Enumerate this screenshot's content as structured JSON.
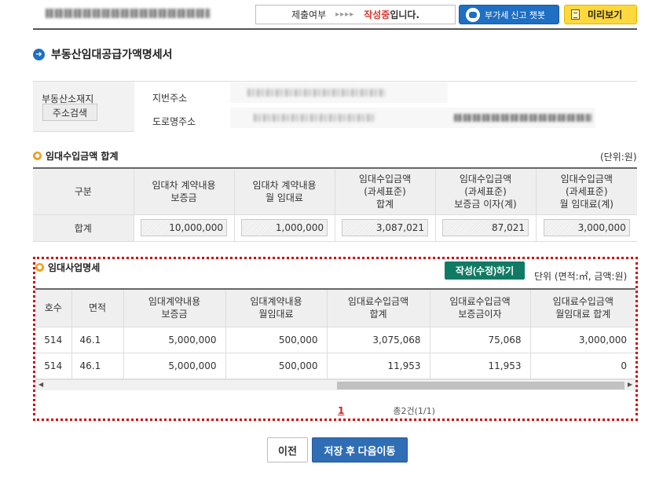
{
  "header": {
    "status_prefix": "제출여부",
    "status_arrows": "▸▸▸▸",
    "status_value": "작성중",
    "status_suffix": "입니다.",
    "chatbot_label": "부가세 신고 챗봇",
    "preview_label": "미리보기"
  },
  "page": {
    "title": "부동산임대공급가액명세서"
  },
  "address": {
    "label": "부동산소재지",
    "search_button": "주소검색",
    "jibun_label": "지번주소",
    "road_label": "도로명주소"
  },
  "summary": {
    "title": "임대수입금액 합계",
    "unit": "(단위:원)",
    "headers": [
      [
        "구분"
      ],
      [
        "임대차 계약내용",
        "보증금"
      ],
      [
        "임대차 계약내용",
        "월 임대료"
      ],
      [
        "임대수입금액",
        "(과세표준)",
        "합계"
      ],
      [
        "임대수입금액",
        "(과세표준)",
        "보증금 이자(계)"
      ],
      [
        "임대수입금액",
        "(과세표준)",
        "월 임대료(계)"
      ]
    ],
    "row_label": "합계",
    "values": [
      "10,000,000",
      "1,000,000",
      "3,087,021",
      "87,021",
      "3,000,000"
    ]
  },
  "detail": {
    "title": "임대사업명세",
    "edit_button": "작성(수정)하기",
    "unit": "단위 (면적:㎡, 금액:원)",
    "headers": [
      [
        "호수"
      ],
      [
        "면적"
      ],
      [
        "임대계약내용",
        "보증금"
      ],
      [
        "임대계약내용",
        "월임대료"
      ],
      [
        "임대료수입금액",
        "합계"
      ],
      [
        "임대료수입금액",
        "보증금이자"
      ],
      [
        "임대료수입금액",
        "월임대료 합계"
      ]
    ],
    "rows": [
      [
        "514",
        "46.1",
        "5,000,000",
        "500,000",
        "3,075,068",
        "75,068",
        "3,000,000"
      ],
      [
        "514",
        "46.1",
        "5,000,000",
        "500,000",
        "11,953",
        "11,953",
        "0"
      ]
    ],
    "pager": {
      "current": "1",
      "total": "총2건(1/1)"
    }
  },
  "footer": {
    "prev_button": "이전",
    "next_button": "저장 후 다음이동"
  },
  "colors": {
    "primary_blue": "#1f6fc2",
    "status_red": "#d63a2f",
    "edit_green": "#117a63",
    "preview_yellow": "#ffd83d",
    "highlight_red": "#d40000"
  }
}
